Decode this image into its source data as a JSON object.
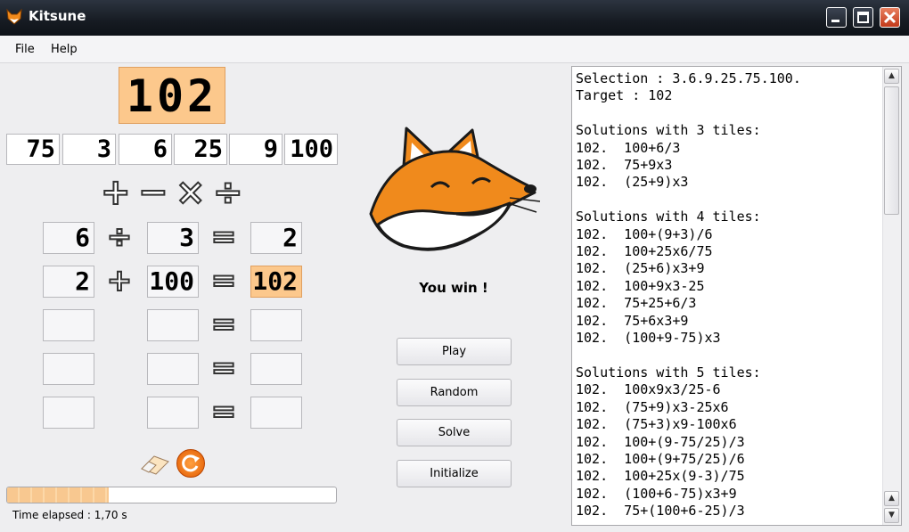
{
  "window": {
    "title": "Kitsune"
  },
  "menu": {
    "file": "File",
    "help": "Help"
  },
  "target": "102",
  "tiles": [
    "75",
    "3",
    "6",
    "25",
    "9",
    "100"
  ],
  "operators": {
    "plus": "+",
    "minus": "−",
    "times": "×",
    "divide": "÷"
  },
  "steps": [
    {
      "a": "6",
      "op": "÷",
      "b": "3",
      "eq": "=",
      "result": "2",
      "highlight": false
    },
    {
      "a": "2",
      "op": "+",
      "b": "100",
      "eq": "=",
      "result": "102",
      "highlight": true
    },
    {
      "a": "",
      "op": "",
      "b": "",
      "eq": "=",
      "result": "",
      "highlight": false
    },
    {
      "a": "",
      "op": "",
      "b": "",
      "eq": "=",
      "result": "",
      "highlight": false
    },
    {
      "a": "",
      "op": "",
      "b": "",
      "eq": "=",
      "result": "",
      "highlight": false
    }
  ],
  "message": "You win !",
  "buttons": {
    "play": "Play",
    "random": "Random",
    "solve": "Solve",
    "initialize": "Initialize"
  },
  "progress_fraction": 0.31,
  "status": "Time elapsed : 1,70 s",
  "solutions_text": "Selection : 3.6.9.25.75.100.\nTarget : 102\n\nSolutions with 3 tiles:\n102.  100+6/3\n102.  75+9x3\n102.  (25+9)x3\n\nSolutions with 4 tiles:\n102.  100+(9+3)/6\n102.  100+25x6/75\n102.  (25+6)x3+9\n102.  100+9x3-25\n102.  75+25+6/3\n102.  75+6x3+9\n102.  (100+9-75)x3\n\nSolutions with 5 tiles:\n102.  100x9x3/25-6\n102.  (75+9)x3-25x6\n102.  (75+3)x9-100x6\n102.  100+(9-75/25)/3\n102.  100+(9+75/25)/6\n102.  100+25x(9-3)/75\n102.  (100+6-75)x3+9\n102.  75+(100+6-25)/3",
  "colors": {
    "highlight": "#fcc88c",
    "fox_orange": "#f08a1c",
    "titlebar": "#1e232b",
    "close": "#d04a28"
  },
  "icons": {
    "app": "fox-icon",
    "eraser": "eraser-icon",
    "refresh": "refresh-icon",
    "up": "arrow-up-icon",
    "down": "arrow-down-icon"
  }
}
